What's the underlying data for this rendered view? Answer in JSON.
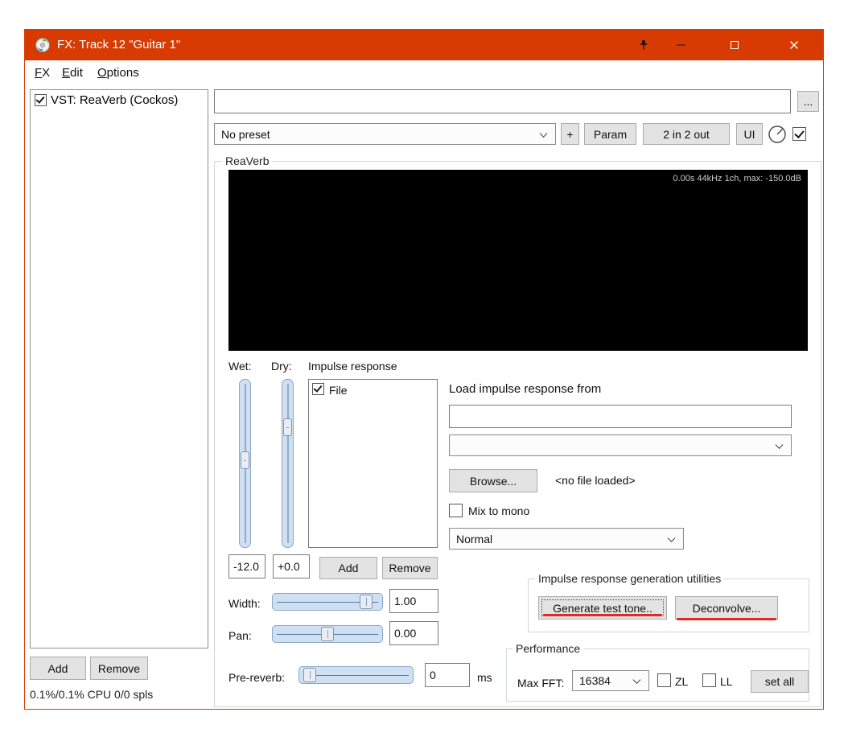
{
  "window": {
    "title": "FX: Track 12 \"Guitar 1\"",
    "accent_color": "#d83b01",
    "annotation_color": "#e8281e"
  },
  "menu": {
    "items": [
      {
        "key": "F",
        "rest": "X"
      },
      {
        "key": "E",
        "rest": "dit"
      },
      {
        "key": "O",
        "rest": "ptions"
      }
    ]
  },
  "fx_chain": {
    "items": [
      {
        "label": "VST: ReaVerb (Cockos)",
        "checked": true
      }
    ],
    "add_button": "Add",
    "remove_button": "Remove",
    "cpu_status": "0.1%/0.1% CPU 0/0 spls"
  },
  "header": {
    "fx_comment_value": "",
    "more_button": "...",
    "preset_value": "No preset",
    "plus_button": "+",
    "param_button": "Param",
    "io_button": "2 in 2 out",
    "ui_button": "UI",
    "enabled_checkbox_checked": true
  },
  "reaverb": {
    "group_label": "ReaVerb",
    "display_info": "0.00s 44kHz 1ch, max: -150.0dB",
    "wet": {
      "label": "Wet:",
      "value": "-12.0"
    },
    "dry": {
      "label": "Dry:",
      "value": "+0.0"
    },
    "impulse_list": {
      "label": "Impulse response",
      "items": [
        {
          "label": "File",
          "checked": true
        }
      ],
      "add_button": "Add",
      "remove_button": "Remove"
    },
    "load_section": {
      "label": "Load impulse response from",
      "path_value": "",
      "source_value": "",
      "browse_button": "Browse...",
      "file_status": "<no file loaded>",
      "mix_to_mono": {
        "label": "Mix to mono",
        "checked": false
      },
      "mode_value": "Normal"
    },
    "width": {
      "label": "Width:",
      "value": "1.00"
    },
    "pan": {
      "label": "Pan:",
      "value": "0.00"
    },
    "generation": {
      "group_label": "Impulse response generation utilities",
      "generate_button": "Generate test tone..",
      "deconvolve_button": "Deconvolve..."
    },
    "pre_reverb": {
      "label": "Pre-reverb:",
      "value": "0",
      "unit": "ms"
    },
    "performance": {
      "group_label": "Performance",
      "max_fft_label": "Max FFT:",
      "max_fft_value": "16384",
      "zl": {
        "label": "ZL",
        "checked": false
      },
      "ll": {
        "label": "LL",
        "checked": false
      },
      "set_all_button": "set all"
    }
  }
}
